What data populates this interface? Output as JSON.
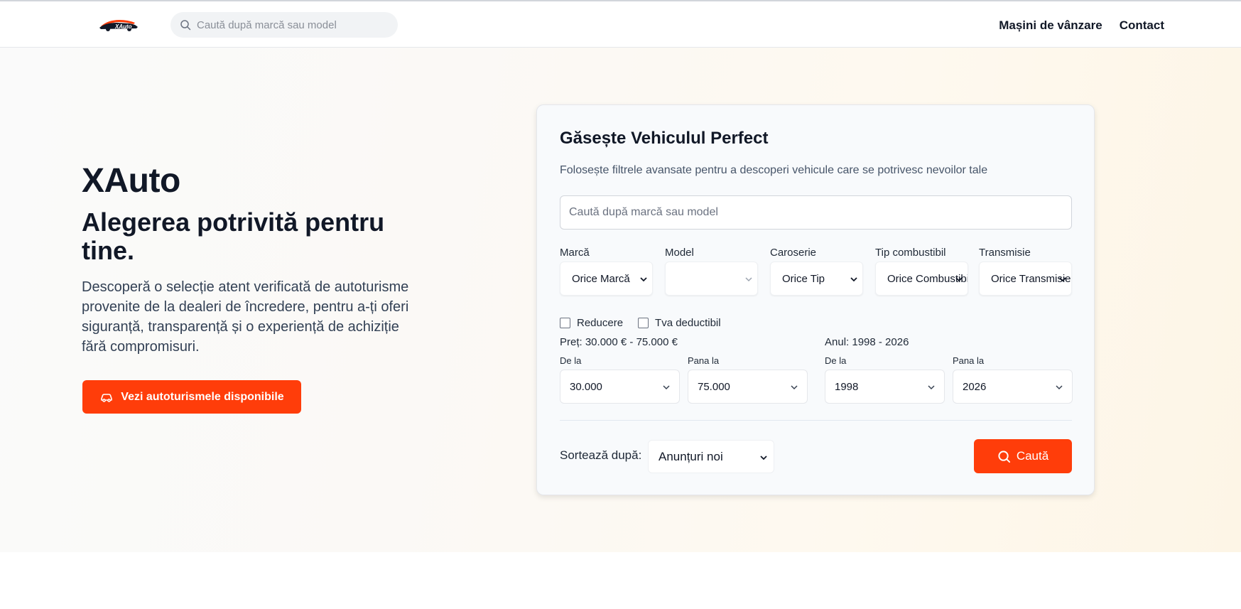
{
  "header": {
    "logo_text": "XAuto",
    "search_placeholder": "Caută după marcă sau model",
    "nav": [
      {
        "label": "Mașini de vânzare"
      },
      {
        "label": "Contact"
      }
    ]
  },
  "hero": {
    "title": "XAuto",
    "subtitle": "Alegerea potrivită pentru tine.",
    "description": "Descoperă o selecție atent verificată de autoturisme provenite de la dealeri de încredere, pentru a-ți oferi siguranță, transparență și o experiență de achiziție fără compromisuri.",
    "cta_label": "Vezi autoturismele disponibile"
  },
  "search_card": {
    "title": "Găsește Vehiculul Perfect",
    "subtitle": "Folosește filtrele avansate pentru a descoperi vehicule care se potrivesc nevoilor tale",
    "search_placeholder": "Caută după marcă sau model",
    "filters": [
      {
        "label": "Marcă",
        "value": "Orice Marcă"
      },
      {
        "label": "Model",
        "value": ""
      },
      {
        "label": "Caroserie",
        "value": "Orice Tip"
      },
      {
        "label": "Tip combustibil",
        "value": "Orice Combustibil"
      },
      {
        "label": "Transmisie",
        "value": "Orice Transmisie"
      }
    ],
    "checkboxes": [
      {
        "label": "Reducere",
        "checked": false
      },
      {
        "label": "Tva deductibil",
        "checked": false
      }
    ],
    "price": {
      "label": "Preț: 30.000 € - 75.000 €",
      "from_label": "De la",
      "from_value": "30.000",
      "to_label": "Pana la",
      "to_value": "75.000"
    },
    "year": {
      "label": "Anul: 1998 - 2026",
      "from_label": "De la",
      "from_value": "1998",
      "to_label": "Pana la",
      "to_value": "2026"
    },
    "sort_label": "Sortează după:",
    "sort_value": "Anunțuri noi",
    "search_button_label": "Caută"
  },
  "colors": {
    "accent": "#ff3d0a",
    "text": "#111827"
  }
}
